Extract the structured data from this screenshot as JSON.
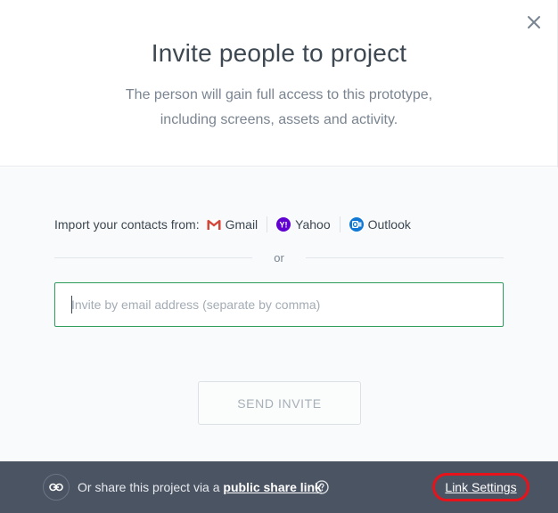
{
  "modal": {
    "title": "Invite people to project",
    "subtitle_line1": "The person will gain full access to this prototype,",
    "subtitle_line2": "including screens, assets and activity."
  },
  "import": {
    "label": "Import your contacts from:",
    "providers": [
      {
        "name": "Gmail",
        "icon": "gmail-icon"
      },
      {
        "name": "Yahoo",
        "icon": "yahoo-icon"
      },
      {
        "name": "Outlook",
        "icon": "outlook-icon"
      }
    ]
  },
  "divider": {
    "or_text": "or"
  },
  "email": {
    "placeholder": "Invite by email address (separate by comma)",
    "value": ""
  },
  "send_button": {
    "label": "SEND INVITE"
  },
  "footer": {
    "share_prefix": "Or share this project via a",
    "share_link": "public share link",
    "link_settings": "Link Settings"
  },
  "colors": {
    "footer_bg": "#4b5463",
    "input_border": "#2e9c5b",
    "highlight": "#e8121a",
    "yahoo": "#6001d2",
    "outlook": "#0f78d4",
    "gmail": "#d44638"
  }
}
